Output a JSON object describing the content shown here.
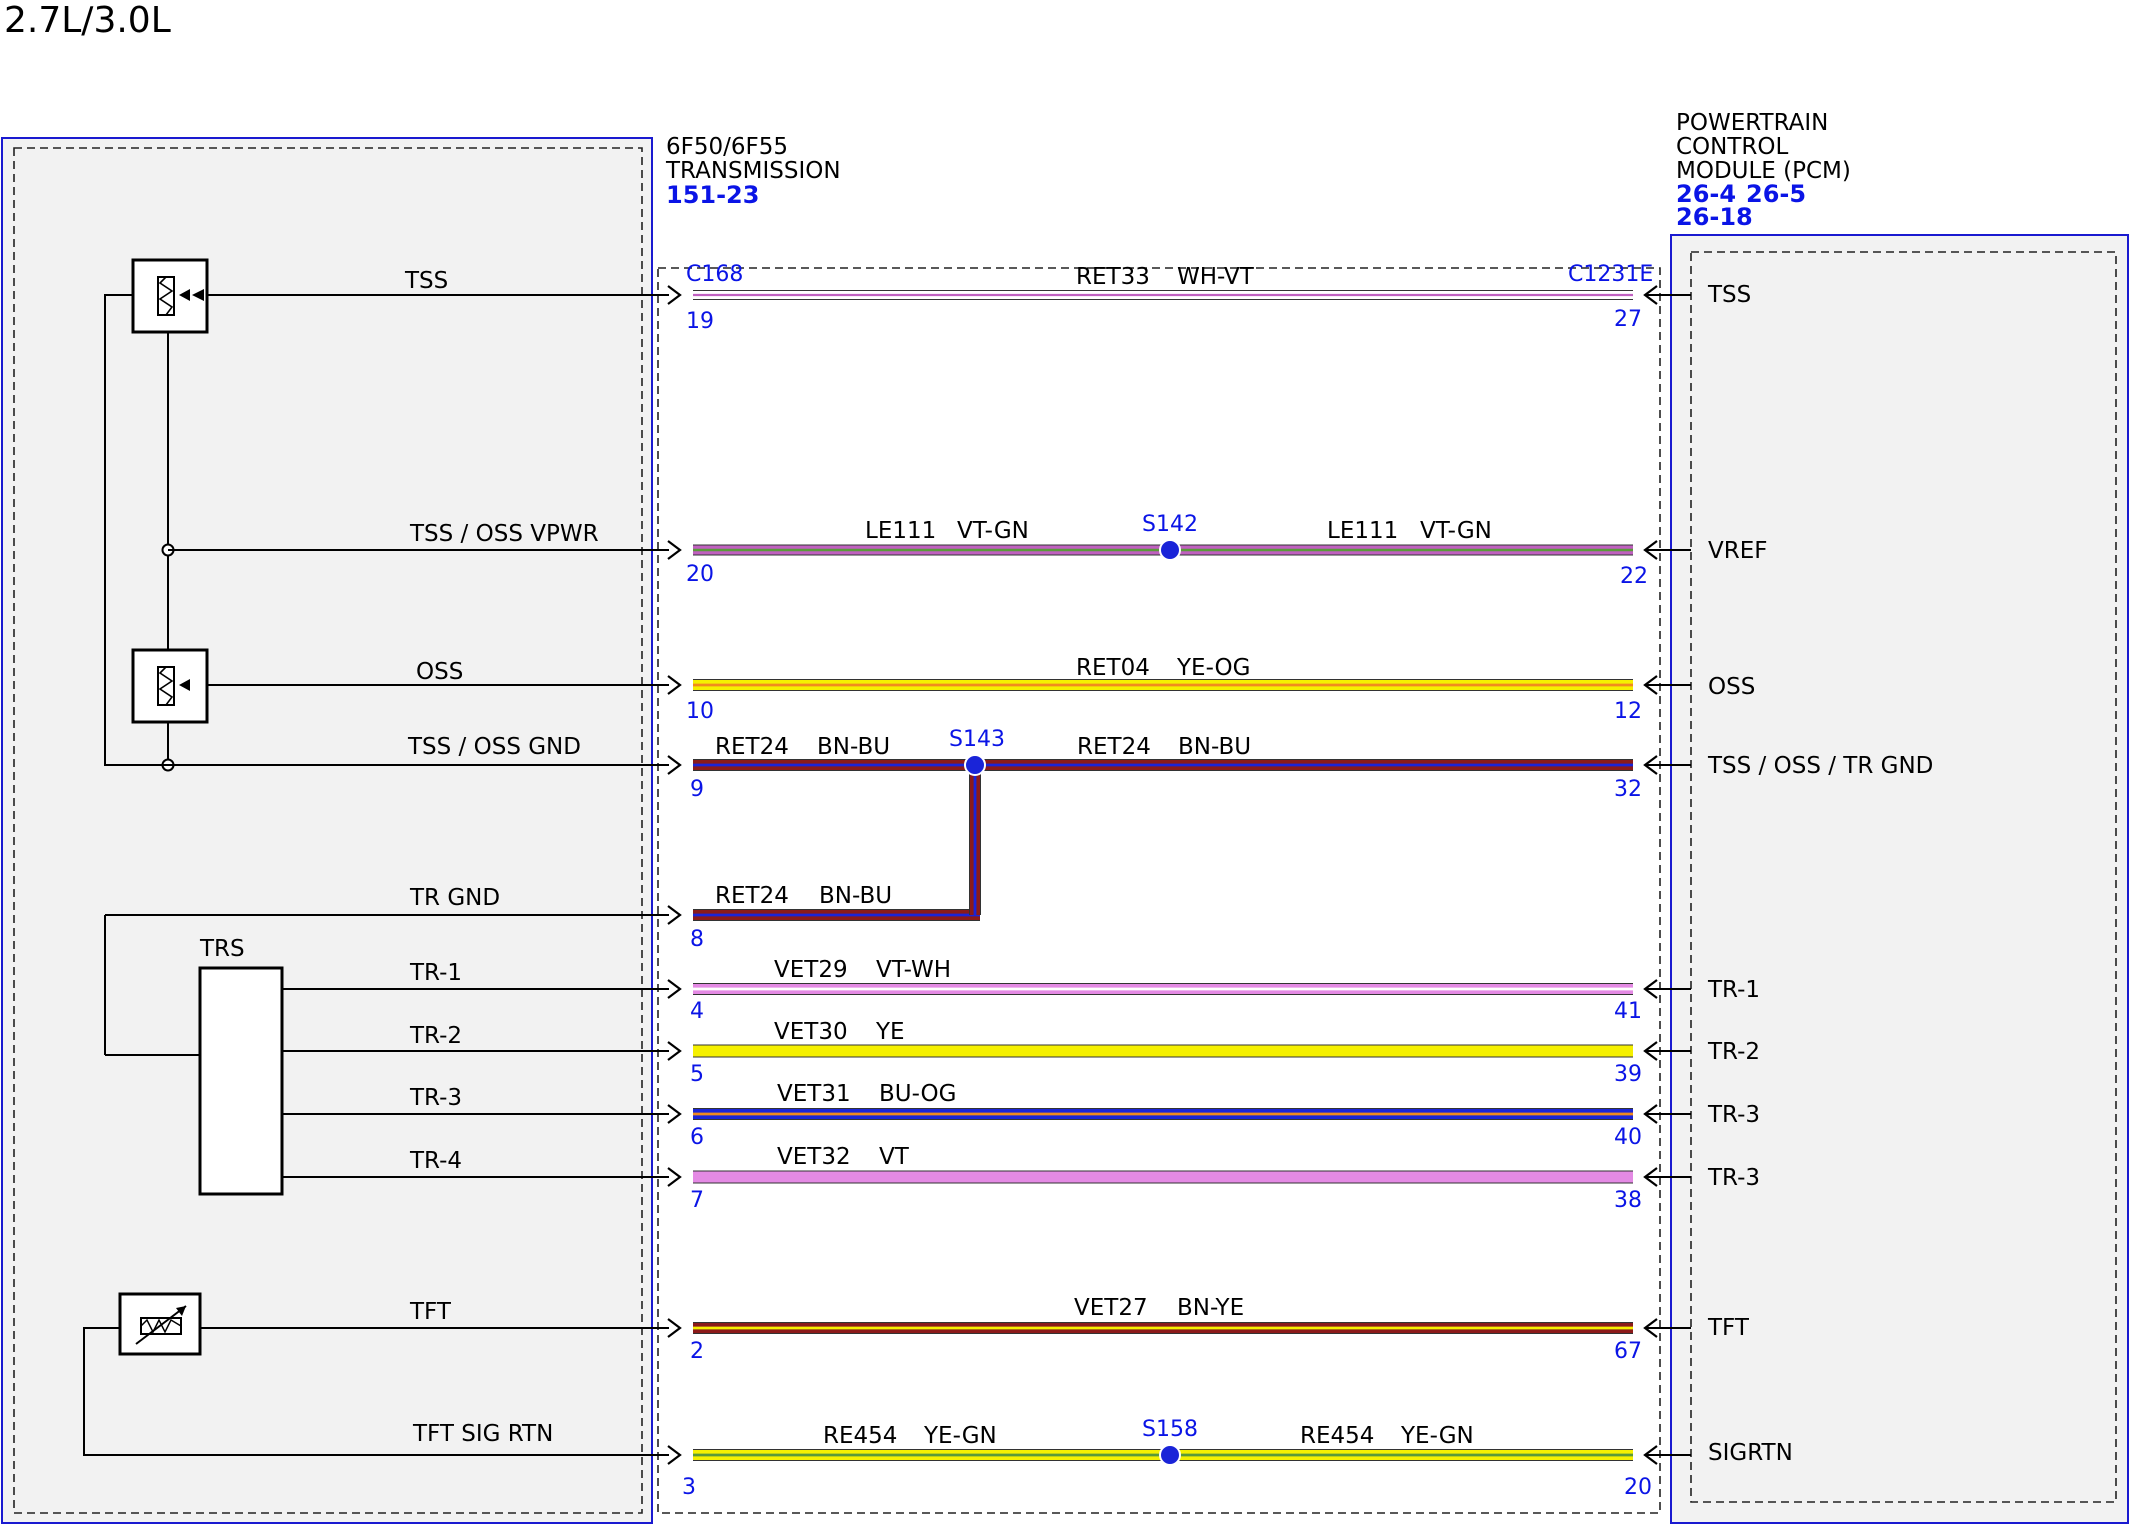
{
  "page": {
    "title": "2.7L/3.0L"
  },
  "transmission": {
    "name_lines": [
      "6F50/6F55",
      "TRANSMISSION"
    ],
    "ref": "151-23",
    "connector": "C168",
    "trs_label": "TRS"
  },
  "pcm": {
    "name_lines": [
      "POWERTRAIN",
      "CONTROL",
      "MODULE (PCM)"
    ],
    "refs": [
      "26-4",
      "26-5",
      "26-18"
    ],
    "connector": "C1231E"
  },
  "circuits": [
    {
      "left_label": "TSS",
      "right_label": "TSS",
      "left_pin": "19",
      "right_pin": "27",
      "segments": [
        {
          "circuit": "RET33",
          "color": "WH-VT"
        }
      ]
    },
    {
      "left_label": "TSS / OSS VPWR",
      "right_label": "VREF",
      "left_pin": "20",
      "right_pin": "22",
      "splice": "S142",
      "segments": [
        {
          "circuit": "LE111",
          "color": "VT-GN"
        },
        {
          "circuit": "LE111",
          "color": "VT-GN"
        }
      ]
    },
    {
      "left_label": "OSS",
      "right_label": "OSS",
      "left_pin": "10",
      "right_pin": "12",
      "segments": [
        {
          "circuit": "RET04",
          "color": "YE-OG"
        }
      ]
    },
    {
      "left_label": "TSS / OSS GND",
      "right_label": "TSS / OSS / TR GND",
      "left_pin": "9",
      "right_pin": "32",
      "splice": "S143",
      "segments": [
        {
          "circuit": "RET24",
          "color": "BN-BU"
        },
        {
          "circuit": "RET24",
          "color": "BN-BU"
        }
      ]
    },
    {
      "left_label": "TR GND",
      "left_pin": "8",
      "segments": [
        {
          "circuit": "RET24",
          "color": "BN-BU"
        }
      ]
    },
    {
      "left_label": "TR-1",
      "right_label": "TR-1",
      "left_pin": "4",
      "right_pin": "41",
      "segments": [
        {
          "circuit": "VET29",
          "color": "VT-WH"
        }
      ]
    },
    {
      "left_label": "TR-2",
      "right_label": "TR-2",
      "left_pin": "5",
      "right_pin": "39",
      "segments": [
        {
          "circuit": "VET30",
          "color": "YE"
        }
      ]
    },
    {
      "left_label": "TR-3",
      "right_label": "TR-3",
      "left_pin": "6",
      "right_pin": "40",
      "segments": [
        {
          "circuit": "VET31",
          "color": "BU-OG"
        }
      ]
    },
    {
      "left_label": "TR-4",
      "right_label": "TR-3",
      "left_pin": "7",
      "right_pin": "38",
      "segments": [
        {
          "circuit": "VET32",
          "color": "VT"
        }
      ]
    },
    {
      "left_label": "TFT",
      "right_label": "TFT",
      "left_pin": "2",
      "right_pin": "67",
      "segments": [
        {
          "circuit": "VET27",
          "color": "BN-YE"
        }
      ]
    },
    {
      "left_label": "TFT SIG RTN",
      "right_label": "SIGRTN",
      "left_pin": "3",
      "right_pin": "20",
      "splice": "S158",
      "segments": [
        {
          "circuit": "RE454",
          "color": "YE-GN"
        },
        {
          "circuit": "RE454",
          "color": "YE-GN"
        }
      ]
    }
  ],
  "wire_colors": {
    "WH": "#ffffff",
    "VT": "#e48ae4",
    "VT_DARK": "#c060c0",
    "GN": "#5a9a3a",
    "YE": "#f5f000",
    "OG": "#f08a1e",
    "BN": "#8b1a1a",
    "BU": "#1a24d8",
    "BLUE_TEXT": "#0a14e6"
  }
}
